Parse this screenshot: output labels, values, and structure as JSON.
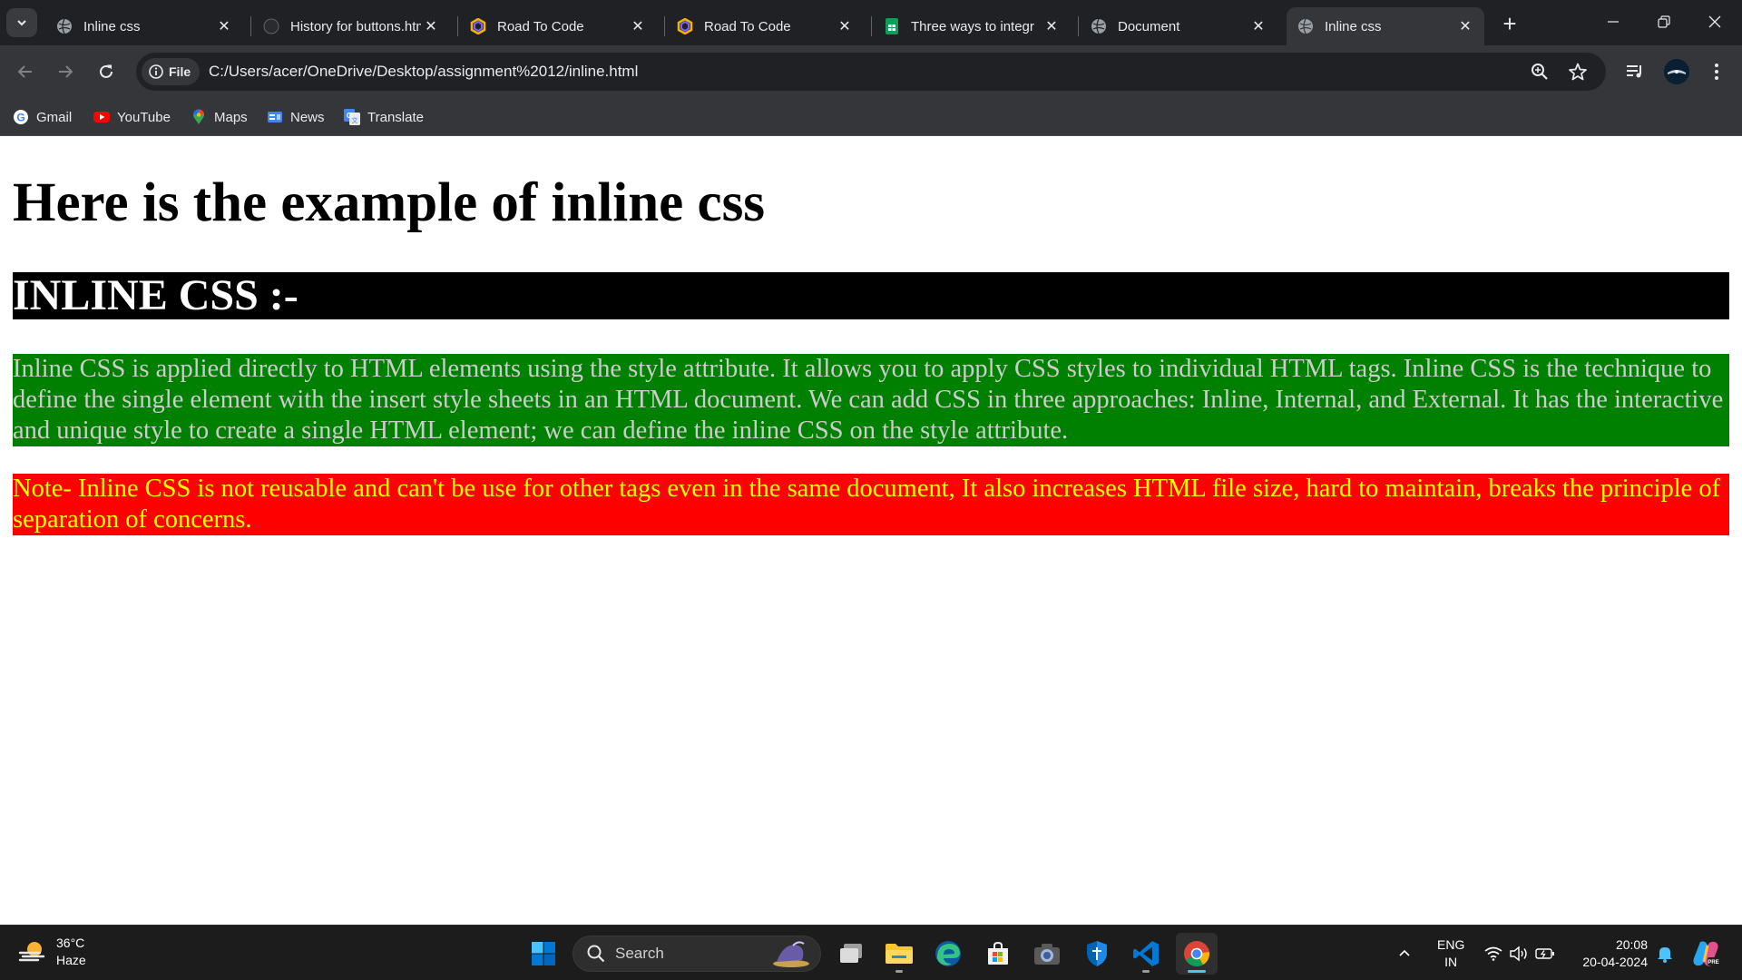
{
  "browser": {
    "tabs": [
      {
        "title": "Inline css",
        "icon": "globe-icon"
      },
      {
        "title": "History for buttons.html",
        "icon": "github-icon"
      },
      {
        "title": "Road To Code",
        "icon": "roadtocode-icon"
      },
      {
        "title": "Road To Code",
        "icon": "roadtocode-icon"
      },
      {
        "title": "Three ways to integr",
        "icon": "sheets-icon"
      },
      {
        "title": "Document",
        "icon": "globe-icon"
      },
      {
        "title": "Inline css",
        "icon": "globe-icon",
        "active": true
      }
    ],
    "address": {
      "chip_label": "File",
      "url": "C:/Users/acer/OneDrive/Desktop/assignment%2012/inline.html"
    },
    "bookmarks": [
      {
        "label": "Gmail",
        "icon": "google-icon"
      },
      {
        "label": "YouTube",
        "icon": "youtube-icon"
      },
      {
        "label": "Maps",
        "icon": "maps-icon"
      },
      {
        "label": "News",
        "icon": "news-icon"
      },
      {
        "label": "Translate",
        "icon": "translate-icon"
      }
    ]
  },
  "page": {
    "heading": "Here is the example of inline css",
    "subheading": "INLINE CSS :-",
    "paragraph": "Inline CSS is applied directly to HTML elements using the style attribute. It allows you to apply CSS styles to individual HTML tags. Inline CSS is the technique to define the single element with the insert style sheets in an HTML document. We can add CSS in three approaches: Inline, Internal, and External. It has the interactive and unique style to create a single HTML element; we can define the inline CSS on the style attribute.",
    "note": "Note- Inline CSS is not reusable and can't be use for other tags even in the same document, It also increases HTML file size, hard to maintain, breaks the principle of separation of concerns.",
    "colors": {
      "subheading_bg": "#000000",
      "paragraph_bg": "#008000",
      "paragraph_fg": "#cccccc",
      "note_bg": "#ff0000",
      "note_fg": "#ffff00"
    }
  },
  "taskbar": {
    "weather": {
      "temp": "36°C",
      "condition": "Haze"
    },
    "search_placeholder": "Search",
    "language": {
      "lang": "ENG",
      "region": "IN"
    },
    "clock": {
      "time": "20:08",
      "date": "20-04-2024"
    }
  }
}
